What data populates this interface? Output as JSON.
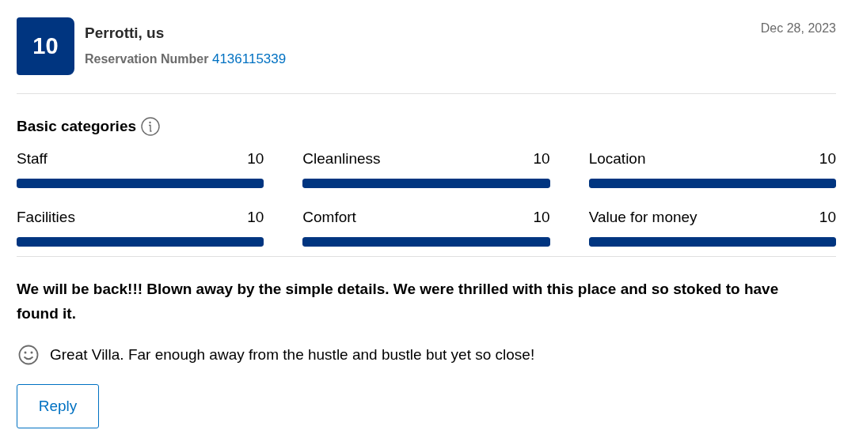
{
  "review": {
    "score": "10",
    "reviewer": "Perrotti, us",
    "reservation_label": "Reservation Number",
    "reservation_number": "4136115339",
    "date": "Dec 28, 2023"
  },
  "categories": {
    "title": "Basic categories",
    "items": [
      {
        "name": "Staff",
        "score": "10",
        "level": 1
      },
      {
        "name": "Cleanliness",
        "score": "10",
        "level": 1
      },
      {
        "name": "Location",
        "score": "10",
        "level": 1
      },
      {
        "name": "Facilities",
        "score": "10",
        "level": 1
      },
      {
        "name": "Comfort",
        "score": "10",
        "level": 1
      },
      {
        "name": "Value for money",
        "score": "10",
        "level": 1
      }
    ]
  },
  "headline": "We will be back!!! Blown away by the simple details. We were thrilled with this place and so stoked to have found it.",
  "positive_comment": "Great Villa. Far enough away from the hustle and bustle but yet so close!",
  "buttons": [
    "Reply"
  ]
}
